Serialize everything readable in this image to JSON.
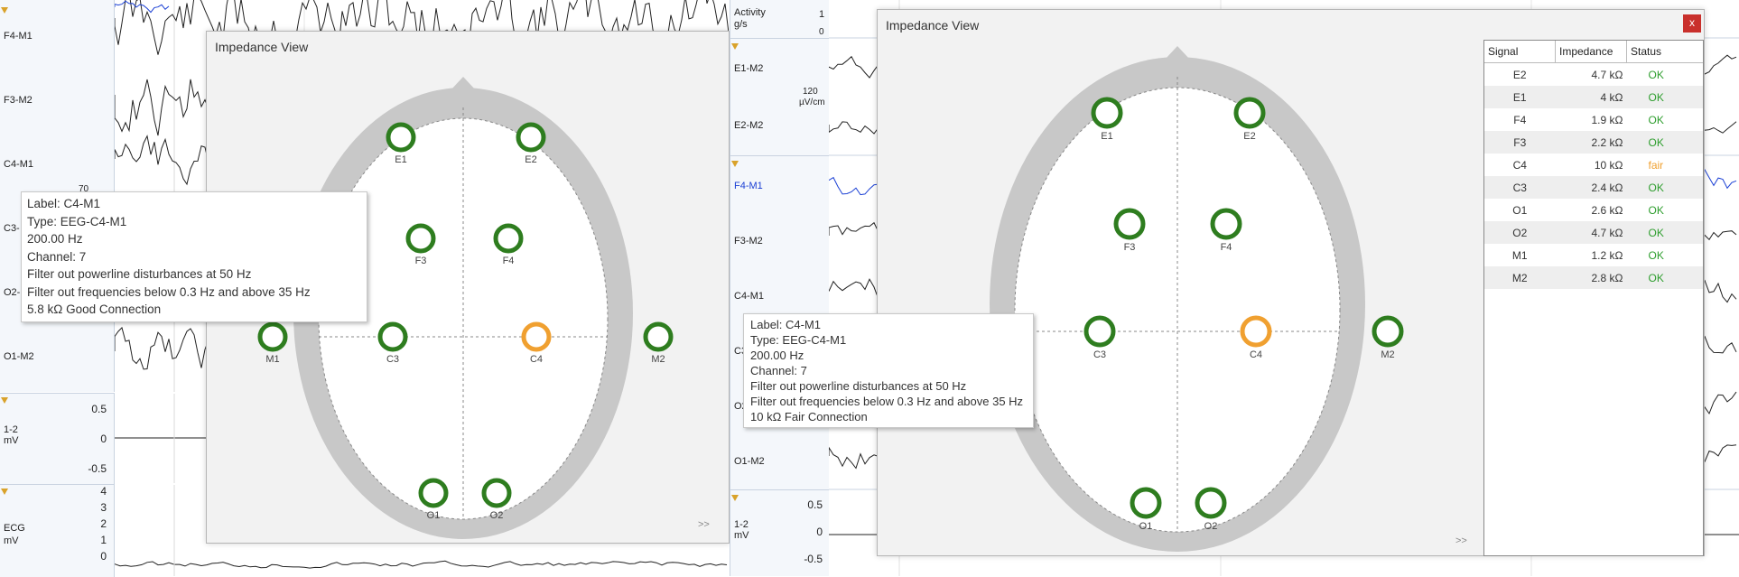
{
  "left": {
    "channels": [
      "F4-M1",
      "F3-M2",
      "C4-M1",
      "C3-",
      "O2-",
      "O1-M2"
    ],
    "scale_70": "70",
    "chart12": {
      "label": "1-2",
      "unit": "mV",
      "ticks": [
        "0.5",
        "0",
        "-0.5"
      ]
    },
    "ecg": {
      "label": "ECG",
      "unit": "mV",
      "ticks": [
        "4",
        "3",
        "2",
        "1",
        "0"
      ]
    },
    "window": {
      "title": "Impedance View",
      "electrodes": [
        {
          "name": "E1",
          "status": "ok"
        },
        {
          "name": "E2",
          "status": "ok"
        },
        {
          "name": "F3",
          "status": "ok"
        },
        {
          "name": "F4",
          "status": "ok"
        },
        {
          "name": "M1",
          "status": "ok"
        },
        {
          "name": "C3",
          "status": "ok"
        },
        {
          "name": "C4",
          "status": "fair"
        },
        {
          "name": "M2",
          "status": "ok"
        },
        {
          "name": "O1",
          "status": "ok"
        },
        {
          "name": "O2",
          "status": "ok"
        }
      ],
      "more": ">>"
    },
    "tooltip": {
      "lines": [
        "Label: C4-M1",
        "Type: EEG-C4-M1",
        "200.00 Hz",
        "Channel: 7",
        "Filter out powerline disturbances at 50 Hz",
        "Filter out frequencies below 0.3 Hz and above 35 Hz",
        "5.8 kΩ Good Connection"
      ]
    }
  },
  "middle": {
    "activity": {
      "label": "Activity",
      "unit": "g/s",
      "value": "1",
      "value2": "0"
    },
    "channels_top": [
      "E1-M2",
      "E2-M2"
    ],
    "scale": {
      "value": "120",
      "unit": "µV/cm"
    },
    "channels": [
      "F4-M1",
      "F3-M2",
      "C4-M1",
      "C3",
      "O2",
      "O1-M2"
    ],
    "chart12": {
      "label": "1-2",
      "unit": "mV",
      "ticks": [
        "0.5",
        "0",
        "-0.5"
      ]
    }
  },
  "right": {
    "window": {
      "title": "Impedance View",
      "close": "x",
      "more": ">>",
      "table": {
        "headers": [
          "Signal",
          "Impedance",
          "Status"
        ],
        "rows": [
          {
            "signal": "E2",
            "impedance": "4.7 kΩ",
            "status": "OK"
          },
          {
            "signal": "E1",
            "impedance": "4 kΩ",
            "status": "OK"
          },
          {
            "signal": "F4",
            "impedance": "1.9 kΩ",
            "status": "OK"
          },
          {
            "signal": "F3",
            "impedance": "2.2 kΩ",
            "status": "OK"
          },
          {
            "signal": "C4",
            "impedance": "10 kΩ",
            "status": "fair"
          },
          {
            "signal": "C3",
            "impedance": "2.4 kΩ",
            "status": "OK"
          },
          {
            "signal": "O1",
            "impedance": "2.6 kΩ",
            "status": "OK"
          },
          {
            "signal": "O2",
            "impedance": "4.7 kΩ",
            "status": "OK"
          },
          {
            "signal": "M1",
            "impedance": "1.2 kΩ",
            "status": "OK"
          },
          {
            "signal": "M2",
            "impedance": "2.8 kΩ",
            "status": "OK"
          }
        ]
      }
    },
    "tooltip": {
      "lines": [
        "Label: C4-M1",
        "Type: EEG-C4-M1",
        "200.00 Hz",
        "Channel: 7",
        "Filter out powerline disturbances at 50 Hz",
        "Filter out frequencies below 0.3 Hz and above 35 Hz",
        "10 kΩ Fair Connection"
      ]
    }
  },
  "colors": {
    "ok": "#2e7d1f",
    "fair": "#f0a030",
    "head": "#c8c8c8",
    "trace": "#222222",
    "trace_blue": "#1a3fd4"
  }
}
